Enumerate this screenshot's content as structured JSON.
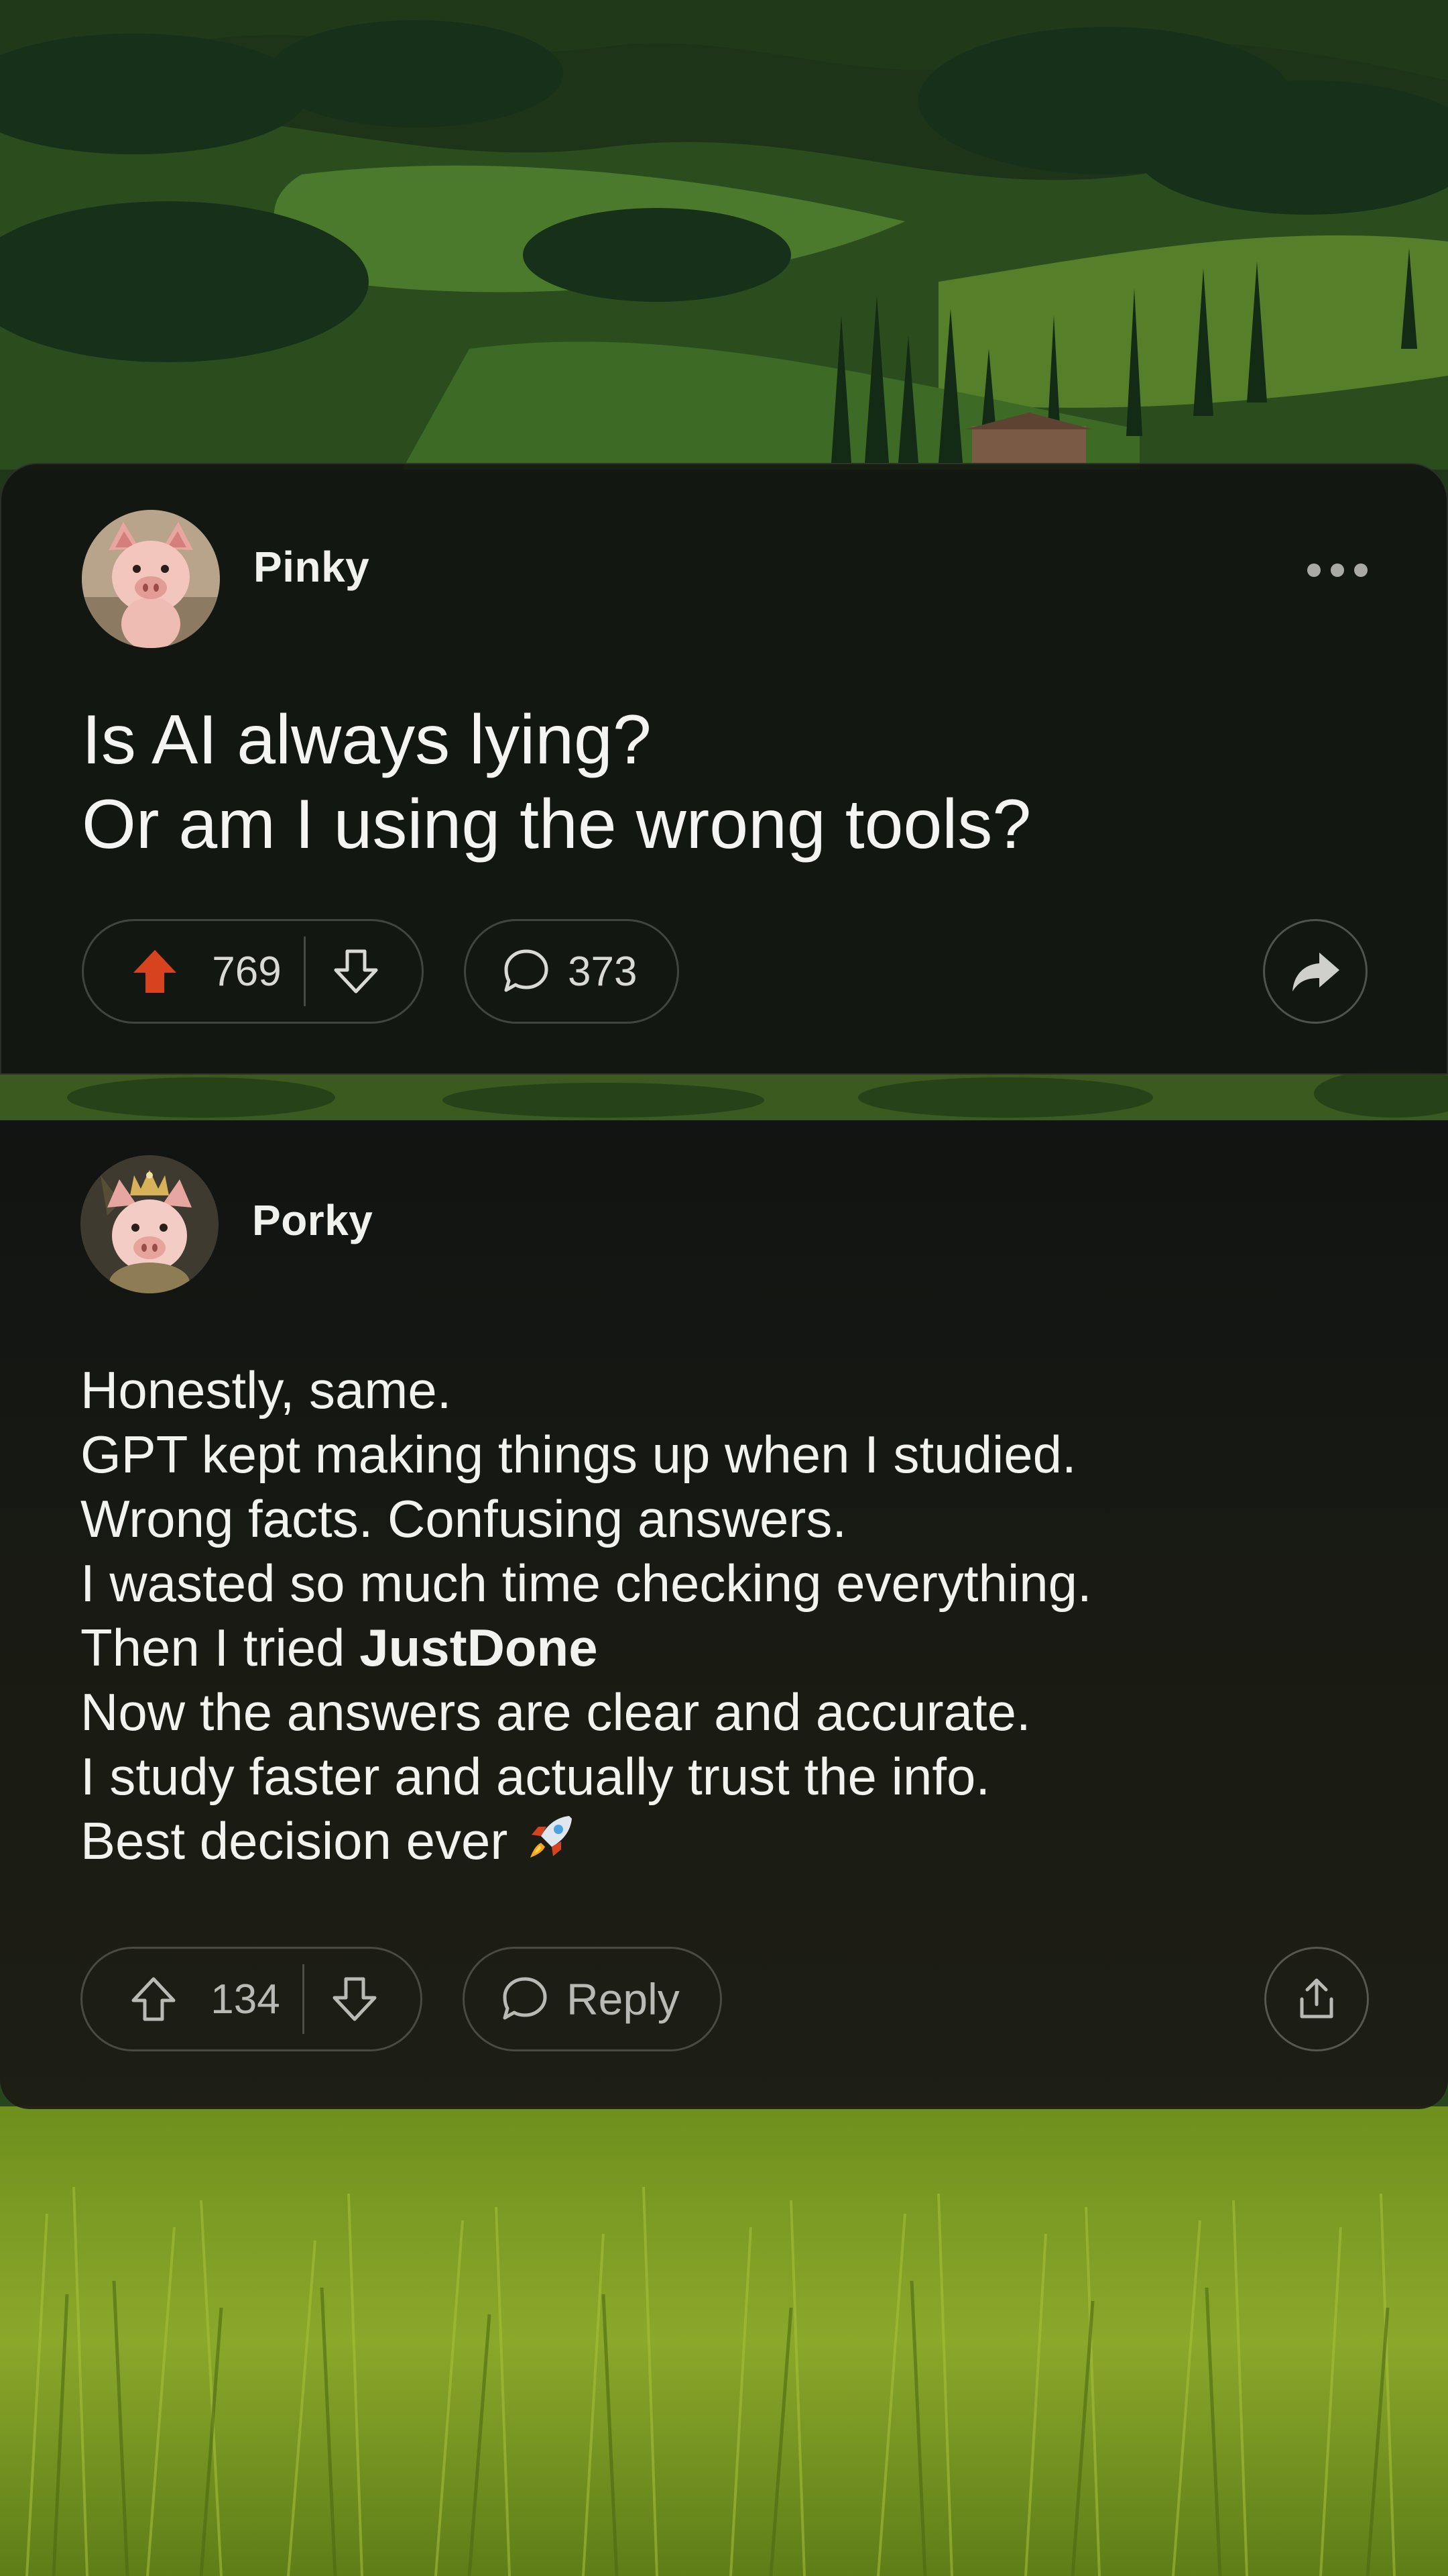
{
  "colors": {
    "upvote_active": "#d8431f",
    "card_background": "#111211",
    "text_primary": "#f4f4f2",
    "icon_muted": "#b9bab5"
  },
  "post": {
    "author": "Pinky",
    "avatar_icon": "pig-avatar-icon",
    "title_lines": [
      "Is AI always lying?",
      "Or am I using the wrong tools?"
    ],
    "upvotes": "769",
    "upvoted": true,
    "comments": "373",
    "more_icon": "more-horizontal-icon",
    "share_icon": "share-arrow-icon"
  },
  "reply": {
    "author": "Porky",
    "avatar_icon": "pig-with-crown-avatar-icon",
    "body": {
      "line1": "Honestly, same.",
      "line2": "GPT kept making things up when I studied.",
      "line3": "Wrong facts. Confusing answers.",
      "line4": "I wasted so much time checking everything.",
      "line5_prefix": "Then I tried ",
      "line5_bold": "JustDone",
      "line6": "Now the answers are clear and accurate.",
      "line7": "I study faster and actually trust the info.",
      "line8": "Best decision ever",
      "line8_emoji": "rocket-emoji"
    },
    "upvotes": "134",
    "upvoted": false,
    "reply_label": "Reply",
    "share_icon": "share-upload-icon"
  }
}
